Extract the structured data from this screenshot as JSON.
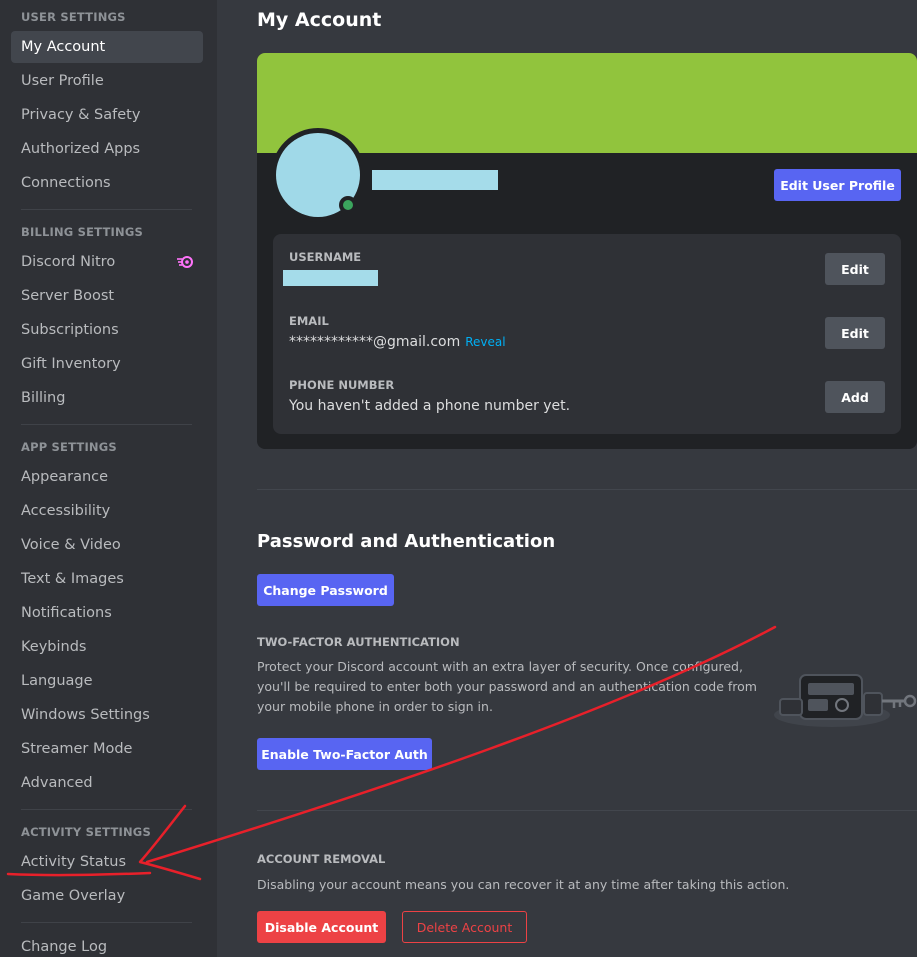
{
  "sidebar": {
    "headers": {
      "user_settings": "User Settings",
      "billing_settings": "Billing Settings",
      "app_settings": "App Settings",
      "activity_settings": "Activity Settings"
    },
    "user_items": [
      "My Account",
      "User Profile",
      "Privacy & Safety",
      "Authorized Apps",
      "Connections"
    ],
    "billing_items": [
      "Discord Nitro",
      "Server Boost",
      "Subscriptions",
      "Gift Inventory",
      "Billing"
    ],
    "app_items": [
      "Appearance",
      "Accessibility",
      "Voice & Video",
      "Text & Images",
      "Notifications",
      "Keybinds",
      "Language",
      "Windows Settings",
      "Streamer Mode",
      "Advanced"
    ],
    "activity_items": [
      "Activity Status",
      "Game Overlay"
    ],
    "change_log": "Change Log",
    "selected": "My Account"
  },
  "main": {
    "title": "My Account",
    "profile": {
      "banner_color": "#91c43d",
      "status": "online",
      "edit_profile_label": "Edit User Profile",
      "username_label": "Username",
      "email_label": "Email",
      "email_value": "************@gmail.com",
      "reveal_label": "Reveal",
      "phone_label": "Phone Number",
      "phone_value": "You haven't added a phone number yet.",
      "edit_label": "Edit",
      "add_label": "Add"
    },
    "password_auth": {
      "title": "Password and Authentication",
      "change_password_label": "Change Password",
      "twofa_header": "Two-Factor Authentication",
      "twofa_description": "Protect your Discord account with an extra layer of security. Once configured, you'll be required to enter both your password and an authentication code from your mobile phone in order to sign in.",
      "enable_twofa_label": "Enable Two-Factor Auth"
    },
    "account_removal": {
      "header": "Account Removal",
      "description": "Disabling your account means you can recover it at any time after taking this action.",
      "disable_label": "Disable Account",
      "delete_label": "Delete Account"
    }
  },
  "colors": {
    "accent": "#5865f2",
    "danger": "#ed4245",
    "annotation": "#e8202a"
  }
}
